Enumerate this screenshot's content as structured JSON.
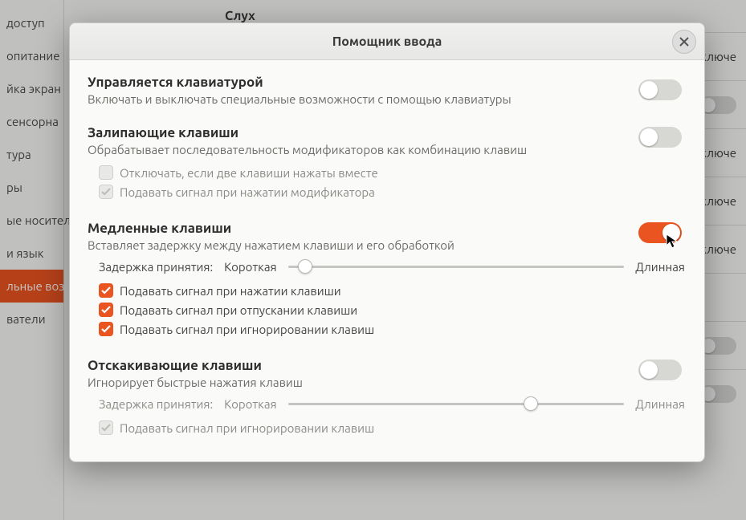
{
  "background": {
    "header": "Слух",
    "sidebar": [
      "доступ",
      "опитание",
      "йка экран",
      "сенсорна",
      "тура",
      "ры",
      "ые носител",
      "и язык",
      "льные воз",
      "ватели"
    ],
    "active_index": 8,
    "rows": [
      {
        "label": "",
        "value": "Выключе",
        "toggle": false
      },
      {
        "label": "",
        "value": "",
        "toggle": true
      },
      {
        "label": "",
        "value": "Включе",
        "toggle": false
      },
      {
        "label": "",
        "value": "Включе",
        "toggle": false
      },
      {
        "label": "",
        "value": "Включе",
        "toggle": false
      },
      {
        "label": "",
        "value": "",
        "toggle": false
      },
      {
        "label": "",
        "value": "",
        "toggle": true
      },
      {
        "label": "",
        "value": "",
        "toggle": true
      }
    ]
  },
  "dialog": {
    "title": "Помощник ввода",
    "sections": {
      "keyboard": {
        "title": "Управляется клавиатурой",
        "desc": "Включать и выключать специальные возможности с помощью клавиатуры",
        "on": false
      },
      "sticky": {
        "title": "Залипающие клавиши",
        "desc": "Обрабатывает последовательность модификаторов как комбинацию клавиш",
        "on": false,
        "opt1": "Отключать, если две клавиши нажаты вместе",
        "opt2": "Подавать сигнал при нажатии модификатора"
      },
      "slow": {
        "title": "Медленные клавиши",
        "desc": "Вставляет задержку между нажатием клавиши и его обработкой",
        "on": true,
        "delay_label": "Задержка принятия:",
        "delay_short": "Короткая",
        "delay_long": "Длинная",
        "delay_pos_pct": 3,
        "c1": "Подавать сигнал при нажатии клавиши",
        "c2": "Подавать сигнал при отпускании клавиши",
        "c3": "Подавать сигнал при игнорировании клавиш"
      },
      "bounce": {
        "title": "Отскакивающие клавиши",
        "desc": "Игнорирует быстрые нажатия клавиш",
        "on": false,
        "delay_label": "Задержка принятия:",
        "delay_short": "Короткая",
        "delay_long": "Длинная",
        "delay_pos_pct": 70,
        "c1": "Подавать сигнал при игнорировании клавиш"
      }
    }
  }
}
